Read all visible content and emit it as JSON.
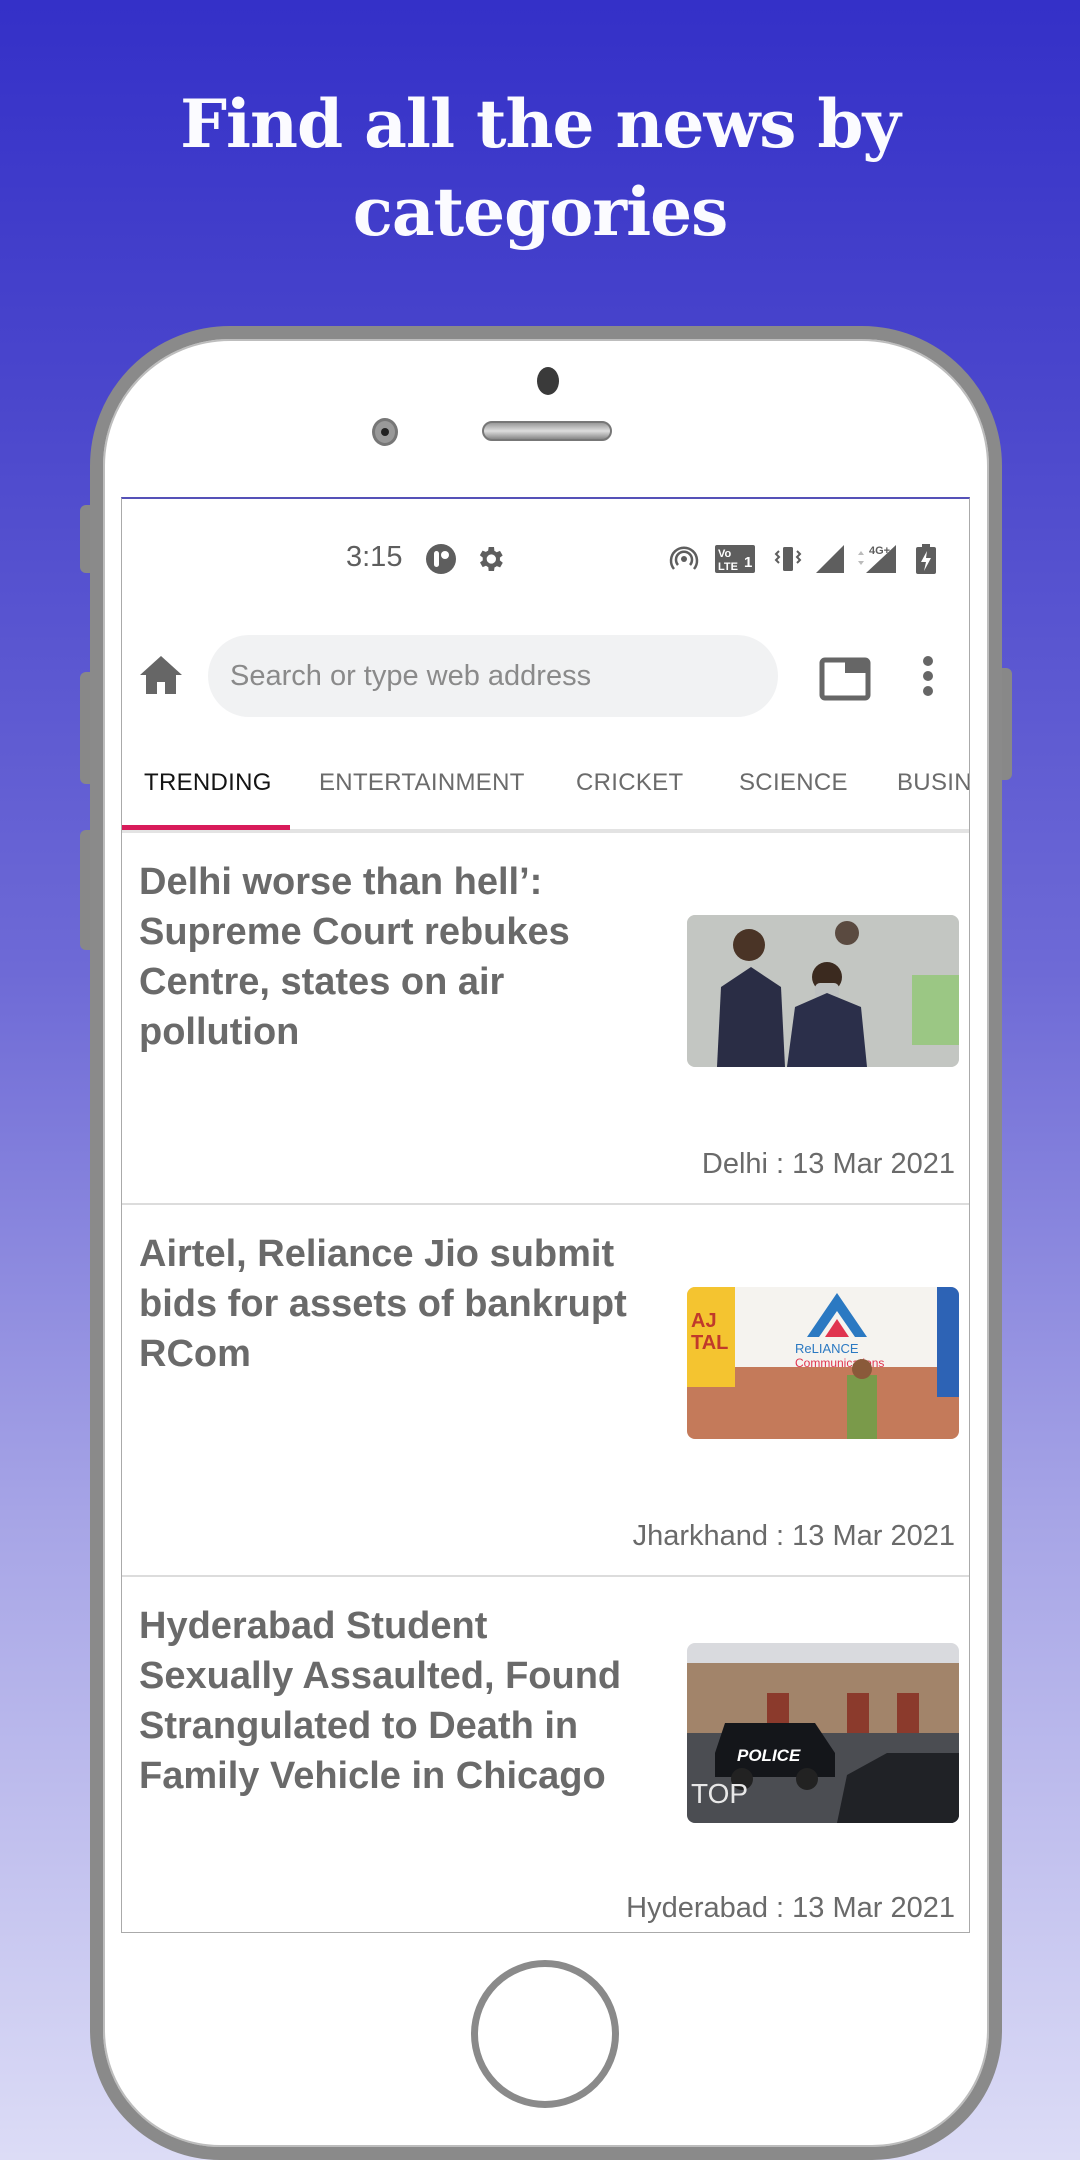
{
  "promo": {
    "headline_line1": "Find all the news by",
    "headline_line2": "categories"
  },
  "status_bar": {
    "time": "3:15",
    "left_icons": [
      "assistant-icon",
      "settings-gear-icon"
    ],
    "right_icons": [
      "hotspot-icon",
      "volte-icon",
      "vibrate-icon",
      "signal-icon",
      "4g-plus-signal-icon",
      "battery-charging-icon"
    ],
    "volte_label": "VoLTE 1",
    "network_label": "4G+"
  },
  "browser": {
    "search_placeholder": "Search or type web address",
    "search_value": ""
  },
  "tabs": [
    {
      "label": "TRENDING",
      "active": true
    },
    {
      "label": "ENTERTAINMENT",
      "active": false
    },
    {
      "label": "CRICKET",
      "active": false
    },
    {
      "label": "SCIENCE",
      "active": false
    },
    {
      "label": "BUSIN",
      "active": false
    }
  ],
  "accent_color": "#d81b5a",
  "articles": [
    {
      "title": "Delhi worse than hell’: Supreme Court rebukes Centre, states on air pollution",
      "meta": "Delhi : 13 Mar 2021",
      "image": "students-wearing-masks-photo"
    },
    {
      "title": "Airtel, Reliance Jio submit bids for assets of bankrupt RCom",
      "meta": "Jharkhand : 13 Mar 2021",
      "image": "reliance-communications-store-photo"
    },
    {
      "title": "Hyderabad Student Sexually Assaulted, Found Strangulated to Death in Family Vehicle in Chicago",
      "meta": "Hyderabad : 13 Mar 2021",
      "image": "police-car-photo"
    }
  ]
}
